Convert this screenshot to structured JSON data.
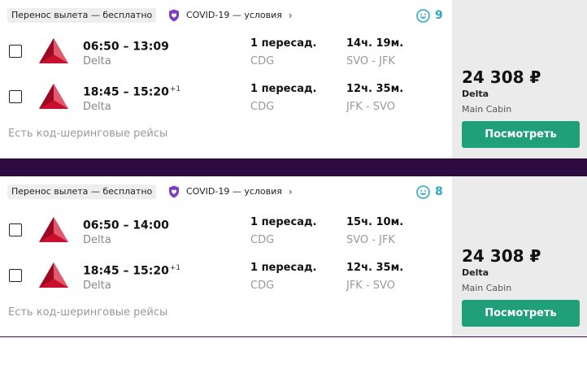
{
  "cards": [
    {
      "badge": "Перенос вылета — бесплатно",
      "covid": "COVID-19 — условия",
      "chevron": "›",
      "smile_count": "9",
      "segments": [
        {
          "time": "06:50 – 13:09",
          "sup": "",
          "airline": "Delta",
          "stops": "1 пересад.",
          "via": "CDG",
          "duration": "14ч. 19м.",
          "route": "SVO - JFK"
        },
        {
          "time": "18:45 – 15:20",
          "sup": "+1",
          "airline": "Delta",
          "stops": "1 пересад.",
          "via": "CDG",
          "duration": "12ч. 35м.",
          "route": "JFK - SVO"
        }
      ],
      "codeshare": "Есть код-шеринговые рейсы",
      "price": "24 308 ₽",
      "carrier": "Delta",
      "cabin": "Main Cabin",
      "button": "Посмотреть"
    },
    {
      "badge": "Перенос вылета — бесплатно",
      "covid": "COVID-19 — условия",
      "chevron": "›",
      "smile_count": "8",
      "segments": [
        {
          "time": "06:50 – 14:00",
          "sup": "",
          "airline": "Delta",
          "stops": "1 пересад.",
          "via": "CDG",
          "duration": "15ч. 10м.",
          "route": "SVO - JFK"
        },
        {
          "time": "18:45 – 15:20",
          "sup": "+1",
          "airline": "Delta",
          "stops": "1 пересад.",
          "via": "CDG",
          "duration": "12ч. 35м.",
          "route": "JFK - SVO"
        }
      ],
      "codeshare": "Есть код-шеринговые рейсы",
      "price": "24 308 ₽",
      "carrier": "Delta",
      "cabin": "Main Cabin",
      "button": "Посмотреть"
    }
  ],
  "colors": {
    "button": "#20a078",
    "smile": "#2da8c9",
    "shield": "#7b3fbf",
    "divider": "#2d0a3f",
    "delta_red": "#c8102e"
  },
  "icons": {
    "shield": "heart-shield-icon",
    "smile": "smile-icon",
    "logo": "delta-logo"
  }
}
